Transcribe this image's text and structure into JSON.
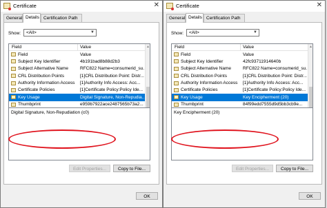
{
  "windows": [
    {
      "title": "Certificate",
      "tabs": [
        "General",
        "Details",
        "Certification Path"
      ],
      "show_label": "Show:",
      "show_value": "<All>",
      "columns": {
        "field": "Field",
        "value": "Value"
      },
      "rows": [
        {
          "field": "Field",
          "value": "Value"
        },
        {
          "field": "Subject Key Identifier",
          "value": "4b191bad8b88d2b3"
        },
        {
          "field": "Subject Alternative Name",
          "value": "RFC822 Name=consumerid_su..."
        },
        {
          "field": "CRL Distribution Points",
          "value": "[1]CRL Distribution Point: Distr..."
        },
        {
          "field": "Authority Information Access",
          "value": "[1]Authority Info Access: Acc..."
        },
        {
          "field": "Certificate Policies",
          "value": "[1]Certificate Policy:Policy Ide..."
        },
        {
          "field": "Key Usage",
          "value": "Digital Signature, Non-Repudia..."
        },
        {
          "field": "Thumbprint",
          "value": "e959b7922ace2487565b73a2..."
        }
      ],
      "selected_row": 6,
      "detail_text": "Digital Signature, Non-Repudiation (c0)",
      "edit_button": "Edit Properties...",
      "copy_button": "Copy to File...",
      "ok_button": "OK"
    },
    {
      "title": "Certificate",
      "tabs": [
        "General",
        "Details",
        "Certification Path"
      ],
      "show_label": "Show:",
      "show_value": "<All>",
      "columns": {
        "field": "Field",
        "value": "Value"
      },
      "rows": [
        {
          "field": "Field",
          "value": "Value"
        },
        {
          "field": "Subject Key Identifier",
          "value": "42fc93711914640b"
        },
        {
          "field": "Subject Alternative Name",
          "value": "RFC822 Name=consumerid_su..."
        },
        {
          "field": "CRL Distribution Points",
          "value": "[1]CRL Distribution Point: Distr..."
        },
        {
          "field": "Authority Information Access",
          "value": "[1]Authority Info Access: Acc..."
        },
        {
          "field": "Certificate Policies",
          "value": "[1]Certificate Policy:Policy Ide..."
        },
        {
          "field": "Key Usage",
          "value": "Key Encipherment (20)"
        },
        {
          "field": "Thumbprint",
          "value": "84f99edd7555d9d5bb3cb9e..."
        }
      ],
      "selected_row": 6,
      "detail_text": "Key Encipherment (20)",
      "edit_button": "Edit Properties...",
      "copy_button": "Copy to File...",
      "ok_button": "OK"
    }
  ],
  "colors": {
    "selection": "#0078d7",
    "annotation": "#e0141e"
  },
  "icons": {
    "title": "certificate-icon",
    "row": "certificate-field-icon",
    "close": "close-icon"
  }
}
